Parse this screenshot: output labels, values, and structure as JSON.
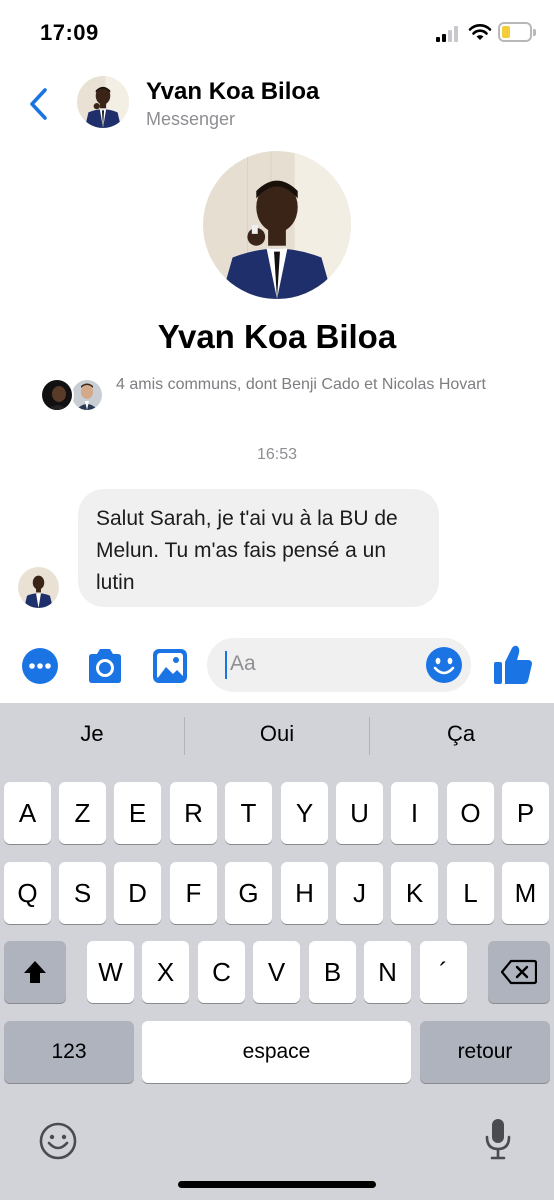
{
  "status_bar": {
    "time": "17:09"
  },
  "header": {
    "name": "Yvan Koa Biloa",
    "subtitle": "Messenger"
  },
  "profile": {
    "name": "Yvan Koa Biloa",
    "mutual_friends": "4 amis communs, dont Benji Cado et Nicolas Hovart"
  },
  "thread": {
    "timestamp": "16:53",
    "messages": [
      {
        "text": "Salut Sarah, je t'ai vu à la BU de Melun. Tu m'as fais pensé a un lutin"
      }
    ]
  },
  "composer": {
    "placeholder": "Aa",
    "icons": [
      "more-icon",
      "camera-icon",
      "gallery-icon",
      "emoji-icon",
      "like-icon"
    ]
  },
  "colors": {
    "accent": "#1b74e4",
    "bubble": "#f0f0f0",
    "keyboard_bg": "#d1d3d9"
  },
  "keyboard": {
    "suggestions": [
      "Je",
      "Oui",
      "Ça"
    ],
    "row1": [
      "A",
      "Z",
      "E",
      "R",
      "T",
      "Y",
      "U",
      "I",
      "O",
      "P"
    ],
    "row2": [
      "Q",
      "S",
      "D",
      "F",
      "G",
      "H",
      "J",
      "K",
      "L",
      "M"
    ],
    "row3": [
      "W",
      "X",
      "C",
      "V",
      "B",
      "N",
      "´"
    ],
    "numbers_label": "123",
    "space_label": "espace",
    "return_label": "retour"
  }
}
